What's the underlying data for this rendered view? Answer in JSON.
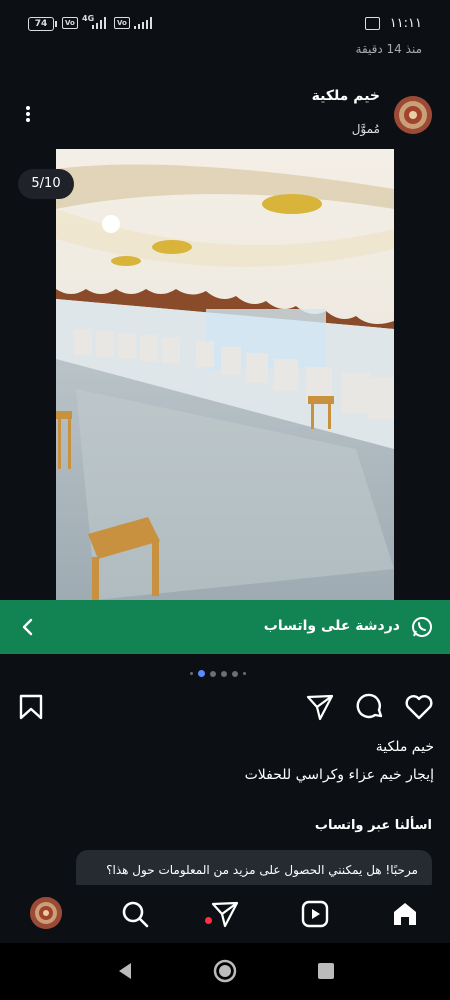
{
  "status_bar": {
    "battery": "74",
    "network": "4G",
    "time": "١١:١١"
  },
  "post": {
    "time_ago": "منذ 14 دقيقة",
    "account_name": "خيم ملكية",
    "sponsored_label": "مُموَّل",
    "image_counter": "5/10",
    "cta_label": "دردشة على واتساب",
    "caption_name": "خيم ملكية",
    "caption_text": "إيجار خيم عزاء وكراسي للحفلات",
    "ask_title": "اسألنا عبر واتساب",
    "message_preview": "مرحبًا! هل يمكنني الحصول على مزيد من المعلومات حول هذا؟"
  },
  "carousel": {
    "total_visible_dots": 6,
    "active_index": 1
  },
  "colors": {
    "background": "#0c1015",
    "whatsapp_green": "#128353",
    "active_dot": "#5b8cff",
    "notification_dot": "#ff3040"
  },
  "icons": {
    "actions": [
      "heart-icon",
      "comment-icon",
      "share-icon",
      "bookmark-icon"
    ],
    "nav": [
      "home-icon",
      "reels-icon",
      "send-icon",
      "search-icon",
      "profile-avatar"
    ],
    "system": [
      "back-icon",
      "home-button-icon",
      "recents-icon"
    ]
  }
}
